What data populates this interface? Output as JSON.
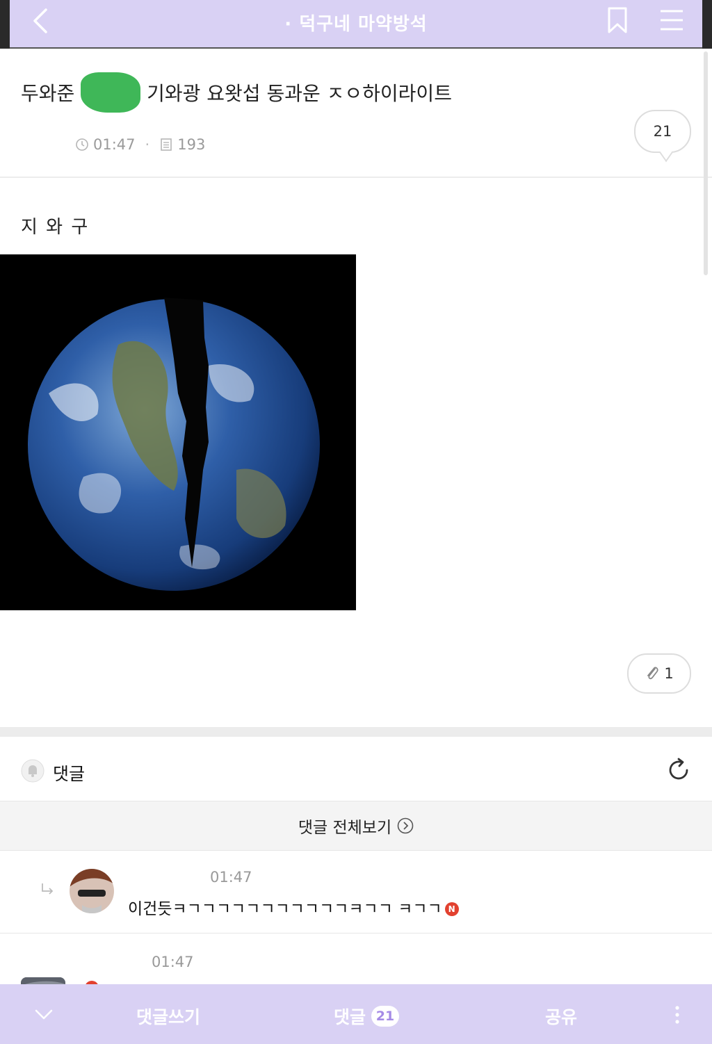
{
  "topbar": {
    "title": "· 덕구네 마약방석"
  },
  "post": {
    "title_prefix": "두와준",
    "title_suffix": "기와광 요왓섭 동과운 ㅈㅇ하이라이트",
    "time": "01:47",
    "views": "193",
    "comment_count": "21",
    "body": "지 와 구",
    "attachment_count": "1"
  },
  "comments": {
    "header": "댓글",
    "view_all": "댓글 전체보기",
    "items": [
      {
        "time": "01:47",
        "text": "이건듯ㅋㄱㄱㄱㄱㄱㄱㄱㄱㄱㄱㄱㅋㄱㄱ ㅋㄱㄱ",
        "badge": "N"
      },
      {
        "time": "01:47",
        "text": "",
        "badge": "N"
      }
    ]
  },
  "bottombar": {
    "write": "댓글쓰기",
    "comments_label": "댓글",
    "comments_count": "21",
    "share": "공유"
  },
  "colors": {
    "accent": "#d9d1f4",
    "badge": "#e2412f",
    "redaction": "#2fb14a"
  }
}
